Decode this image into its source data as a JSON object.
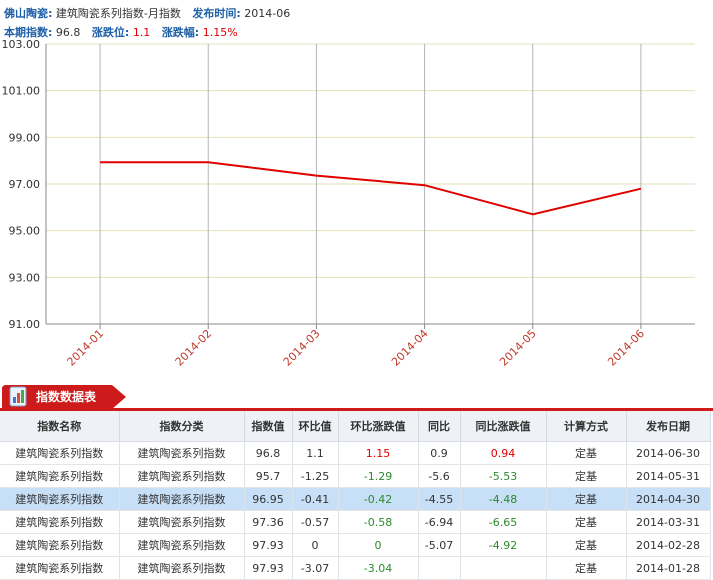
{
  "header": {
    "company_label": "佛山陶瓷:",
    "index_name": "建筑陶瓷系列指数-月指数",
    "publish_label": "发布时间:",
    "publish_value": "2014-06",
    "current_label": "本期指数:",
    "current_value": "96.8",
    "change_label": "涨跌位:",
    "change_value": "1.1",
    "pct_label": "涨跌幅:",
    "pct_value": "1.15%"
  },
  "chart_data": {
    "type": "line",
    "x": [
      "2014-01",
      "2014-02",
      "2014-03",
      "2014-04",
      "2014-05",
      "2014-06"
    ],
    "y_ticks": [
      "103.00",
      "101.00",
      "99.00",
      "97.00",
      "95.00",
      "93.00",
      "91.00"
    ],
    "ylim": [
      91,
      103
    ],
    "series": [
      {
        "values": [
          97.93,
          97.93,
          97.36,
          96.95,
          95.7,
          96.8
        ],
        "color": "#e00000"
      }
    ],
    "grid": true
  },
  "table": {
    "section_title": "指数数据表",
    "headers": [
      "指数名称",
      "指数分类",
      "指数值",
      "环比值",
      "环比涨跌值",
      "同比",
      "同比涨跌值",
      "计算方式",
      "发布日期"
    ],
    "rows": [
      [
        "建筑陶瓷系列指数",
        "建筑陶瓷系列指数",
        "96.8",
        "1.1",
        "1.15",
        "0.9",
        "0.94",
        "定基",
        "2014-06-30"
      ],
      [
        "建筑陶瓷系列指数",
        "建筑陶瓷系列指数",
        "95.7",
        "-1.25",
        "-1.29",
        "-5.6",
        "-5.53",
        "定基",
        "2014-05-31"
      ],
      [
        "建筑陶瓷系列指数",
        "建筑陶瓷系列指数",
        "96.95",
        "-0.41",
        "-0.42",
        "-4.55",
        "-4.48",
        "定基",
        "2014-04-30"
      ],
      [
        "建筑陶瓷系列指数",
        "建筑陶瓷系列指数",
        "97.36",
        "-0.57",
        "-0.58",
        "-6.94",
        "-6.65",
        "定基",
        "2014-03-31"
      ],
      [
        "建筑陶瓷系列指数",
        "建筑陶瓷系列指数",
        "97.93",
        "0",
        "0",
        "-5.07",
        "-4.92",
        "定基",
        "2014-02-28"
      ],
      [
        "建筑陶瓷系列指数",
        "建筑陶瓷系列指数",
        "97.93",
        "-3.07",
        "-3.04",
        "",
        "",
        "定基",
        "2014-01-28"
      ]
    ],
    "highlight_row": 2
  },
  "colors": {
    "accent_red": "#cd1a1a",
    "label_blue": "#1f5fa8",
    "up": "#e00000",
    "down": "#2d8a2d"
  }
}
